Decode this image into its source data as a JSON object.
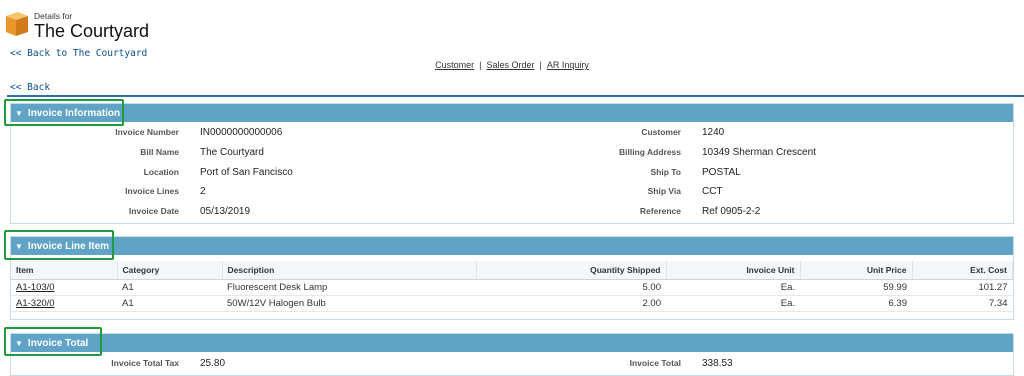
{
  "header": {
    "details_for": "Details for",
    "title": "The Courtyard",
    "logo_icon": "folder-icon"
  },
  "links": {
    "back_to_record": "<< Back to The Courtyard",
    "back": "<< Back"
  },
  "topnav": {
    "customer": "Customer",
    "sales_order": "Sales Order",
    "ar_inquiry": "AR Inquiry",
    "separator": "|"
  },
  "colors": {
    "section_header": "#5fa3c6",
    "highlight_box": "#1f9b3c",
    "rule": "#2f6fa8"
  },
  "invoice_information": {
    "heading": "Invoice Information",
    "left": [
      {
        "label": "Invoice Number",
        "value": "IN0000000000006"
      },
      {
        "label": "Bill Name",
        "value": "The Courtyard"
      },
      {
        "label": "Location",
        "value": "Port of San Fancisco"
      },
      {
        "label": "Invoice Lines",
        "value": "2"
      },
      {
        "label": "Invoice Date",
        "value": "05/13/2019"
      }
    ],
    "right": [
      {
        "label": "Customer",
        "value": "1240"
      },
      {
        "label": "Billing Address",
        "value": "10349 Sherman Crescent"
      },
      {
        "label": "Ship To",
        "value": "POSTAL"
      },
      {
        "label": "Ship Via",
        "value": "CCT"
      },
      {
        "label": "Reference",
        "value": "Ref 0905-2-2"
      }
    ]
  },
  "invoice_line_item": {
    "heading": "Invoice Line Item",
    "columns": [
      "Item",
      "Category",
      "Description",
      "Quantity Shipped",
      "Invoice Unit",
      "Unit Price",
      "Ext. Cost"
    ],
    "rows": [
      [
        "A1-103/0",
        "A1",
        "Fluorescent Desk Lamp",
        "5.00",
        "Ea.",
        "59.99",
        "101.27"
      ],
      [
        "A1-320/0",
        "A1",
        "50W/12V Halogen Bulb",
        "2.00",
        "Ea.",
        "6.39",
        "7.34"
      ]
    ]
  },
  "invoice_total": {
    "heading": "Invoice Total",
    "tax_label": "Invoice Total Tax",
    "tax_value": "25.80",
    "total_label": "Invoice Total",
    "total_value": "338.53"
  }
}
